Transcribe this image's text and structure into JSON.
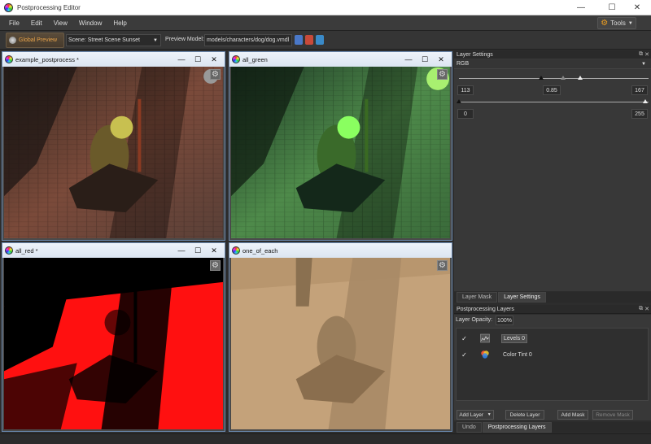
{
  "window": {
    "title": "Postprocessing Editor",
    "min": "—",
    "max": "☐",
    "close": "✕"
  },
  "menu": [
    "File",
    "Edit",
    "View",
    "Window",
    "Help"
  ],
  "tools_label": "Tools",
  "toolbar": {
    "global_preview": "Global Preview",
    "scene": "Scene: Street Scene Sunset",
    "preview_model_label": "Preview Model:",
    "preview_model_value": "models/characters/dog/dog.vmdl"
  },
  "viewports": [
    {
      "title": "example_postprocess *",
      "tint": "normal"
    },
    {
      "title": "all_green",
      "tint": "green"
    },
    {
      "title": "all_red *",
      "tint": "red"
    },
    {
      "title": "one_of_each",
      "tint": "sepia"
    }
  ],
  "viewport_controls": {
    "min": "—",
    "max": "☐",
    "close": "✕",
    "gear": "⚙"
  },
  "layer_settings": {
    "header": "Layer Settings",
    "channel": "RGB",
    "input_min": "113",
    "gamma": "0.85",
    "input_max": "167",
    "output_min": "0",
    "output_max": "255",
    "input_min_level": 113,
    "input_max_level": 167,
    "output_min_level": 0,
    "output_max_level": 255
  },
  "tabs_top": [
    {
      "label": "Layer Mask"
    },
    {
      "label": "Layer Settings"
    }
  ],
  "pp_layers": {
    "header": "Postprocessing Layers",
    "opacity_label": "Layer Opacity:",
    "opacity_value": "100%",
    "layers": [
      {
        "name": "Levels 0",
        "checked": "✓"
      },
      {
        "name": "Color Tint 0",
        "checked": "✓"
      }
    ],
    "buttons": {
      "add_layer": "Add Layer",
      "delete_layer": "Delete Layer",
      "add_mask": "Add Mask",
      "remove_mask": "Remove Mask"
    }
  },
  "tabs_bottom": [
    {
      "label": "Undo"
    },
    {
      "label": "Postprocessing Layers"
    }
  ],
  "panel_controls": {
    "float": "⧉",
    "close": "✕"
  },
  "colors": {
    "accent_orange": "#e6a24a",
    "titlebar_blue": "#dbe5f1",
    "panel_bg": "#383838"
  }
}
